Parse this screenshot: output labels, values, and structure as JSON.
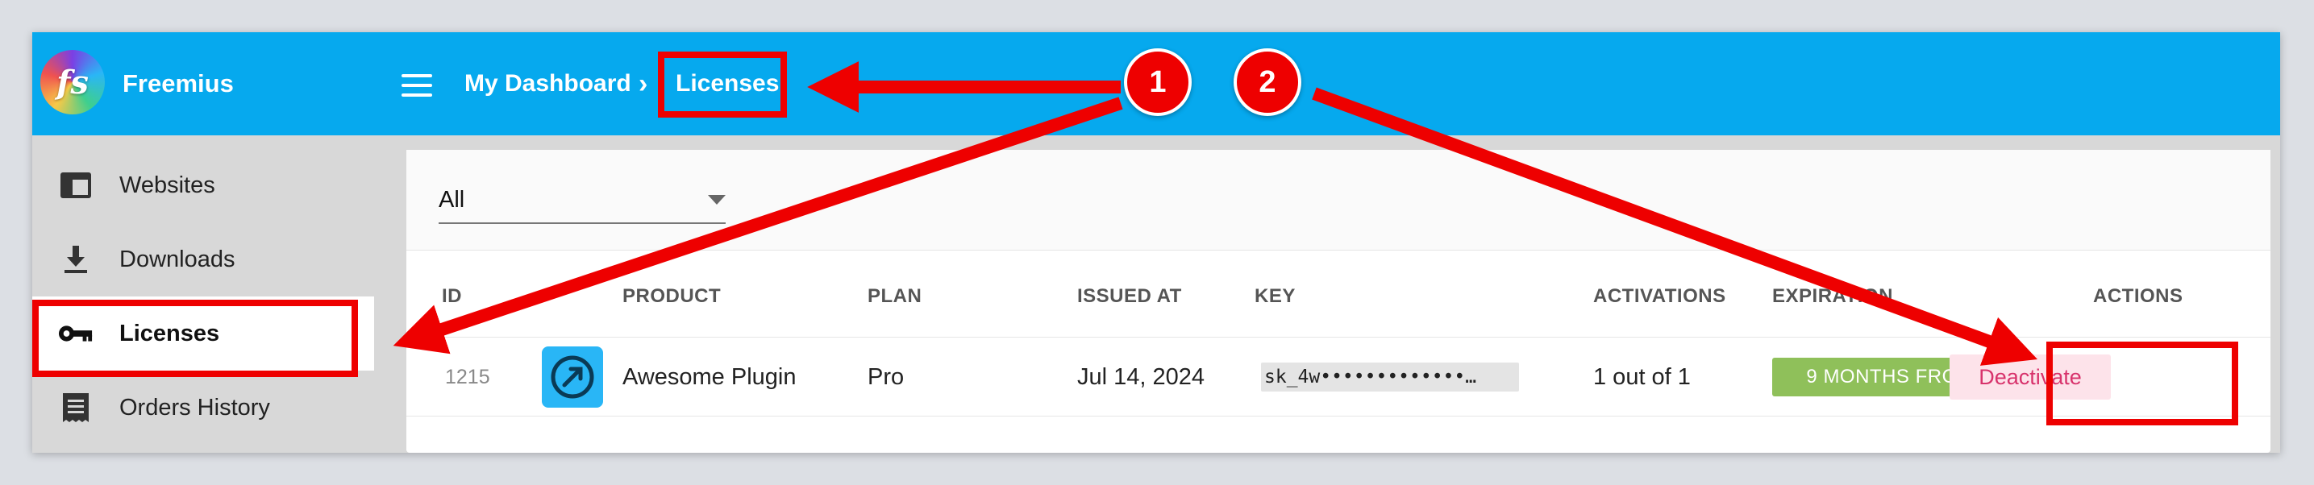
{
  "app": {
    "brand": "Freemius",
    "logo_text": "fs"
  },
  "breadcrumb": {
    "home": "My Dashboard",
    "separator": "›",
    "current": "Licenses"
  },
  "sidebar": {
    "items": [
      {
        "label": "Websites",
        "icon": "website-icon",
        "active": false
      },
      {
        "label": "Downloads",
        "icon": "download-icon",
        "active": false
      },
      {
        "label": "Licenses",
        "icon": "key-icon",
        "active": true
      },
      {
        "label": "Orders History",
        "icon": "receipt-icon",
        "active": false
      }
    ]
  },
  "filter": {
    "selected": "All"
  },
  "table": {
    "headers": [
      "ID",
      "PRODUCT",
      "PLAN",
      "ISSUED AT",
      "KEY",
      "ACTIVATIONS",
      "EXPIRATION",
      "ACTIONS"
    ],
    "rows": [
      {
        "id": "1215",
        "product": "Awesome Plugin",
        "plan": "Pro",
        "issued_at": "Jul 14, 2024",
        "key": "sk_4w•••••••••••••…",
        "activations": "1 out of 1",
        "expiration": "9 MONTHS FROM NOW",
        "action": "Deactivate"
      }
    ]
  },
  "annotations": {
    "callouts": [
      "1",
      "2"
    ]
  },
  "colors": {
    "topbar": "#06a9ee",
    "annotation_red": "#ee0000",
    "expiration_badge": "#8fc05a",
    "deactivate_bg": "#fde3ea",
    "deactivate_text": "#d8336c"
  }
}
